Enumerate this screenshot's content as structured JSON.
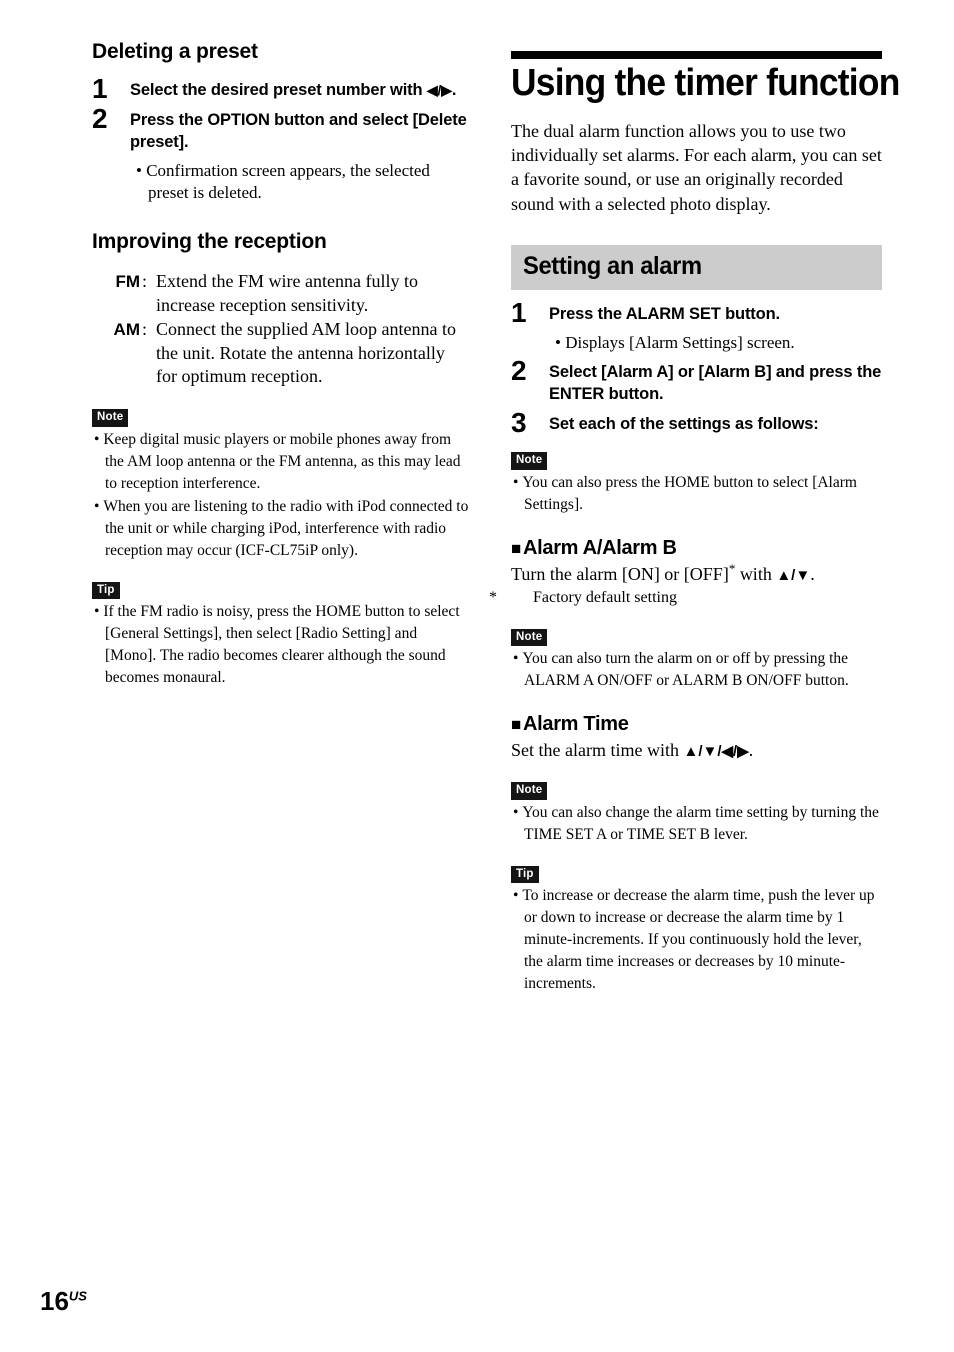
{
  "page": {
    "number": "16",
    "region_suffix": "US"
  },
  "left_column": {
    "section1_heading": "Deleting a preset",
    "steps": [
      {
        "number": "1",
        "text_before_arrows": "Select the desired preset number with ",
        "arrows": "◀/▶",
        "text_after_arrows": "."
      },
      {
        "number": "2",
        "text": "Press the OPTION button and select [Delete preset].",
        "sub_bullets": [
          "Confirmation screen appears, the selected preset is deleted."
        ]
      }
    ],
    "section2_heading": "Improving the reception",
    "reception": [
      {
        "term": "FM",
        "colon": ":",
        "description": "Extend the FM wire antenna fully to increase reception sensitivity."
      },
      {
        "term": "AM",
        "colon": ":",
        "description": "Connect the supplied AM loop antenna to the unit. Rotate the antenna horizontally for optimum reception."
      }
    ],
    "note_badge": "Note",
    "note_items": [
      "Keep digital music players or mobile phones away from the AM loop antenna or the FM antenna, as this may lead to reception interference.",
      "When you are listening to the radio with iPod connected to the unit or while charging iPod, interference with radio reception may occur (ICF-CL75iP only)."
    ],
    "tip_badge": "Tip",
    "tip_items": [
      "If the FM radio is noisy, press the HOME button to select [General Settings], then select [Radio Setting] and [Mono]. The radio becomes clearer although the sound becomes monaural."
    ]
  },
  "right_column": {
    "chapter_title": "Using the timer function",
    "intro": "The dual alarm function allows you to use two individually set alarms. For each alarm, you can set a favorite sound, or use an originally recorded sound with a selected photo display.",
    "section_heading": "Setting an alarm",
    "steps": [
      {
        "number": "1",
        "text": "Press the ALARM SET button.",
        "sub_bullets": [
          "Displays [Alarm Settings] screen."
        ]
      },
      {
        "number": "2",
        "text": "Select [Alarm A] or [Alarm B] and press the ENTER button."
      },
      {
        "number": "3",
        "text": "Set each of the settings as follows:"
      }
    ],
    "note1_badge": "Note",
    "note1_items": [
      "You can also press the HOME button to select [Alarm Settings]."
    ],
    "alarm_ab": {
      "square": "■",
      "heading": "Alarm A/Alarm B",
      "body_before": "Turn the alarm [ON] or [OFF]",
      "star": "*",
      "body_middle": " with ",
      "arrows": "▲/▼",
      "body_after": ".",
      "footnote_star": "*",
      "footnote_text": "Factory default setting"
    },
    "note2_badge": "Note",
    "note2_items": [
      "You can also turn the alarm on or off by pressing the ALARM A ON/OFF or ALARM B ON/OFF button."
    ],
    "alarm_time": {
      "square": "■",
      "heading": "Alarm Time",
      "body_before": "Set the alarm time with ",
      "arrows": "▲/▼/◀/▶",
      "body_after": "."
    },
    "note3_badge": "Note",
    "note3_items": [
      "You can also change the alarm time setting by turning the TIME SET A or TIME SET B lever."
    ],
    "tip_badge": "Tip",
    "tip_items": [
      "To increase or decrease the alarm time, push the lever up or down to increase or decrease the alarm time by 1 minute-increments. If you continuously hold the lever, the alarm time increases or decreases by 10 minute-increments."
    ]
  },
  "colors": {
    "rule": "#000000",
    "section_header_bg": "#cccccc",
    "badge_bg": "#151515",
    "badge_text": "#ffffff",
    "text": "#000000",
    "page_bg": "#ffffff"
  }
}
